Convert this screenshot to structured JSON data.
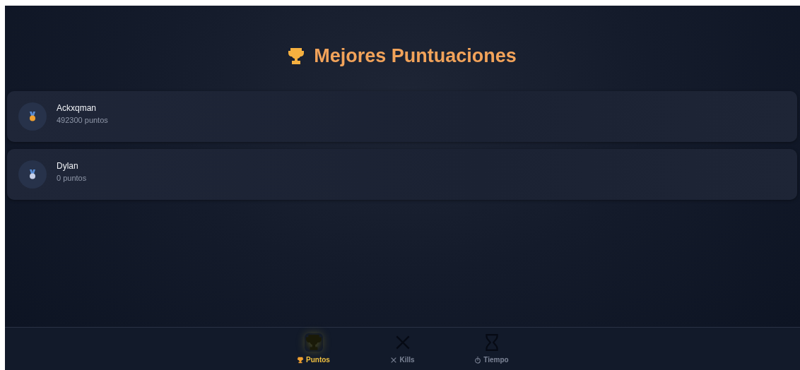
{
  "title": "Mejores Puntuaciones",
  "scores": [
    {
      "name": "Ackxqman",
      "points": "492300 puntos",
      "kind": "gold"
    },
    {
      "name": "Dylan",
      "points": "0 puntos",
      "kind": "silver"
    }
  ],
  "tabs": [
    {
      "label": "Puntos",
      "kind": "trophy",
      "selected": true
    },
    {
      "label": "Kills",
      "kind": "swords",
      "selected": false
    },
    {
      "label": "Tiempo",
      "kind": "hourglass",
      "selected": false
    }
  ]
}
